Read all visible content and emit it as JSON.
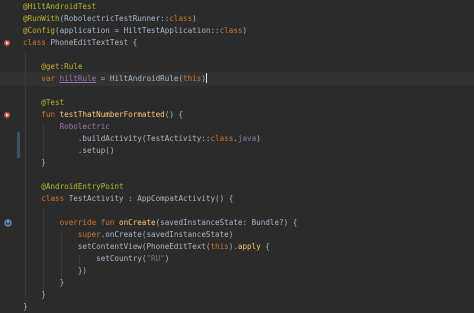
{
  "editor": {
    "theme_colors": {
      "background": "#2b2b2b",
      "current_line": "#323232",
      "keyword": "#cc7832",
      "annotation": "#bbb529",
      "function": "#ffc66d",
      "string": "#6a8759",
      "property": "#9876aa",
      "default_text": "#a9b7c6",
      "change_marker": "#3c4f6b"
    },
    "gutter_icons": {
      "run": "run-test-icon",
      "override": "override-method-icon"
    },
    "lines": [
      [
        {
          "t": "@HiltAndroidTest",
          "c": "ann"
        }
      ],
      [
        {
          "t": "@RunWith",
          "c": "ann"
        },
        {
          "t": "(RobolectricTestRunner::",
          "c": "plain"
        },
        {
          "t": "class",
          "c": "kw"
        },
        {
          "t": ")",
          "c": "plain"
        }
      ],
      [
        {
          "t": "@Config",
          "c": "ann"
        },
        {
          "t": "(application = HiltTestApplication::",
          "c": "plain"
        },
        {
          "t": "class",
          "c": "kw"
        },
        {
          "t": ")",
          "c": "plain"
        }
      ],
      [
        {
          "t": "class ",
          "c": "kw"
        },
        {
          "t": "PhoneEditTextTest {",
          "c": "plain"
        }
      ],
      [],
      [
        {
          "t": "    @get:Rule",
          "c": "ann"
        }
      ],
      [
        {
          "t": "    ",
          "c": "plain"
        },
        {
          "t": "var ",
          "c": "kw"
        },
        {
          "t": "hiltRule",
          "c": "prop underline"
        },
        {
          "t": " = HiltAndroidRule(",
          "c": "plain"
        },
        {
          "t": "this",
          "c": "kw"
        },
        {
          "t": ")",
          "c": "plain"
        }
      ],
      [],
      [
        {
          "t": "    @Test",
          "c": "ann"
        }
      ],
      [
        {
          "t": "    ",
          "c": "plain"
        },
        {
          "t": "fun ",
          "c": "kw"
        },
        {
          "t": "testThatNumberFormatted",
          "c": "fn"
        },
        {
          "t": "() {",
          "c": "plain"
        }
      ],
      [
        {
          "t": "        Robolectric",
          "c": "prop"
        }
      ],
      [
        {
          "t": "            .buildActivity(TestActivity::",
          "c": "plain"
        },
        {
          "t": "class",
          "c": "kw"
        },
        {
          "t": ".",
          "c": "plain"
        },
        {
          "t": "java",
          "c": "prop"
        },
        {
          "t": ")",
          "c": "plain"
        }
      ],
      [
        {
          "t": "            .setup()",
          "c": "plain"
        }
      ],
      [
        {
          "t": "    }",
          "c": "plain"
        }
      ],
      [],
      [
        {
          "t": "    @AndroidEntryPoint",
          "c": "ann"
        }
      ],
      [
        {
          "t": "    ",
          "c": "plain"
        },
        {
          "t": "class ",
          "c": "kw"
        },
        {
          "t": "TestActivity : AppCompatActivity() {",
          "c": "plain"
        }
      ],
      [],
      [
        {
          "t": "        ",
          "c": "plain"
        },
        {
          "t": "override fun ",
          "c": "kw"
        },
        {
          "t": "onCreate",
          "c": "fn"
        },
        {
          "t": "(savedInstanceState: Bundle?) {",
          "c": "plain"
        }
      ],
      [
        {
          "t": "            ",
          "c": "plain"
        },
        {
          "t": "super",
          "c": "kw"
        },
        {
          "t": ".onCreate(savedInstanceState)",
          "c": "plain"
        }
      ],
      [
        {
          "t": "            setContentView(PhoneEditText(",
          "c": "plain"
        },
        {
          "t": "this",
          "c": "kw"
        },
        {
          "t": ").",
          "c": "plain"
        },
        {
          "t": "apply",
          "c": "fn"
        },
        {
          "t": " {",
          "c": "plain"
        }
      ],
      [
        {
          "t": "                setCountry(",
          "c": "plain"
        },
        {
          "t": "\"RU\"",
          "c": "str"
        },
        {
          "t": ")",
          "c": "plain"
        }
      ],
      [
        {
          "t": "            })",
          "c": "plain"
        }
      ],
      [
        {
          "t": "        }",
          "c": "plain"
        }
      ],
      [
        {
          "t": "    }",
          "c": "plain"
        }
      ],
      [
        {
          "t": "}",
          "c": "plain"
        }
      ]
    ]
  }
}
